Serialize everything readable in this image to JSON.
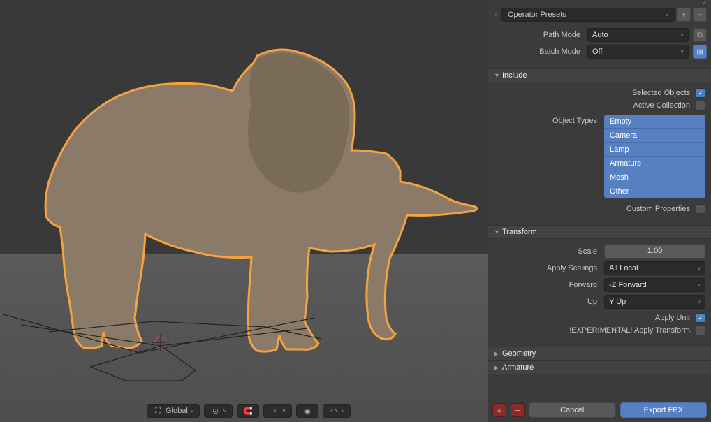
{
  "presets": {
    "label": "Operator Presets"
  },
  "pathMode": {
    "label": "Path Mode",
    "value": "Auto"
  },
  "batchMode": {
    "label": "Batch Mode",
    "value": "Off"
  },
  "sections": {
    "include": {
      "title": "Include",
      "open": true
    },
    "transform": {
      "title": "Transform",
      "open": true
    },
    "geometry": {
      "title": "Geometry",
      "open": false
    },
    "armature": {
      "title": "Armature",
      "open": false
    }
  },
  "include": {
    "selectedObjects": {
      "label": "Selected Objects",
      "checked": true
    },
    "activeCollection": {
      "label": "Active Collection",
      "checked": false
    },
    "objectTypes": {
      "label": "Object Types"
    },
    "types": [
      "Empty",
      "Camera",
      "Lamp",
      "Armature",
      "Mesh",
      "Other"
    ],
    "customProperties": {
      "label": "Custom Properties",
      "checked": false
    }
  },
  "transform": {
    "scale": {
      "label": "Scale",
      "value": "1.00"
    },
    "applyScalings": {
      "label": "Apply Scalings",
      "value": "All Local"
    },
    "forward": {
      "label": "Forward",
      "value": "-Z Forward"
    },
    "up": {
      "label": "Up",
      "value": "Y Up"
    },
    "applyUnit": {
      "label": "Apply Unit",
      "checked": true
    },
    "experimental": {
      "label": "!EXPERIMENTAL! Apply Transform",
      "checked": false
    }
  },
  "footer": {
    "cancel": "Cancel",
    "export": "Export FBX"
  },
  "toolbar": {
    "orientation": "Global"
  }
}
